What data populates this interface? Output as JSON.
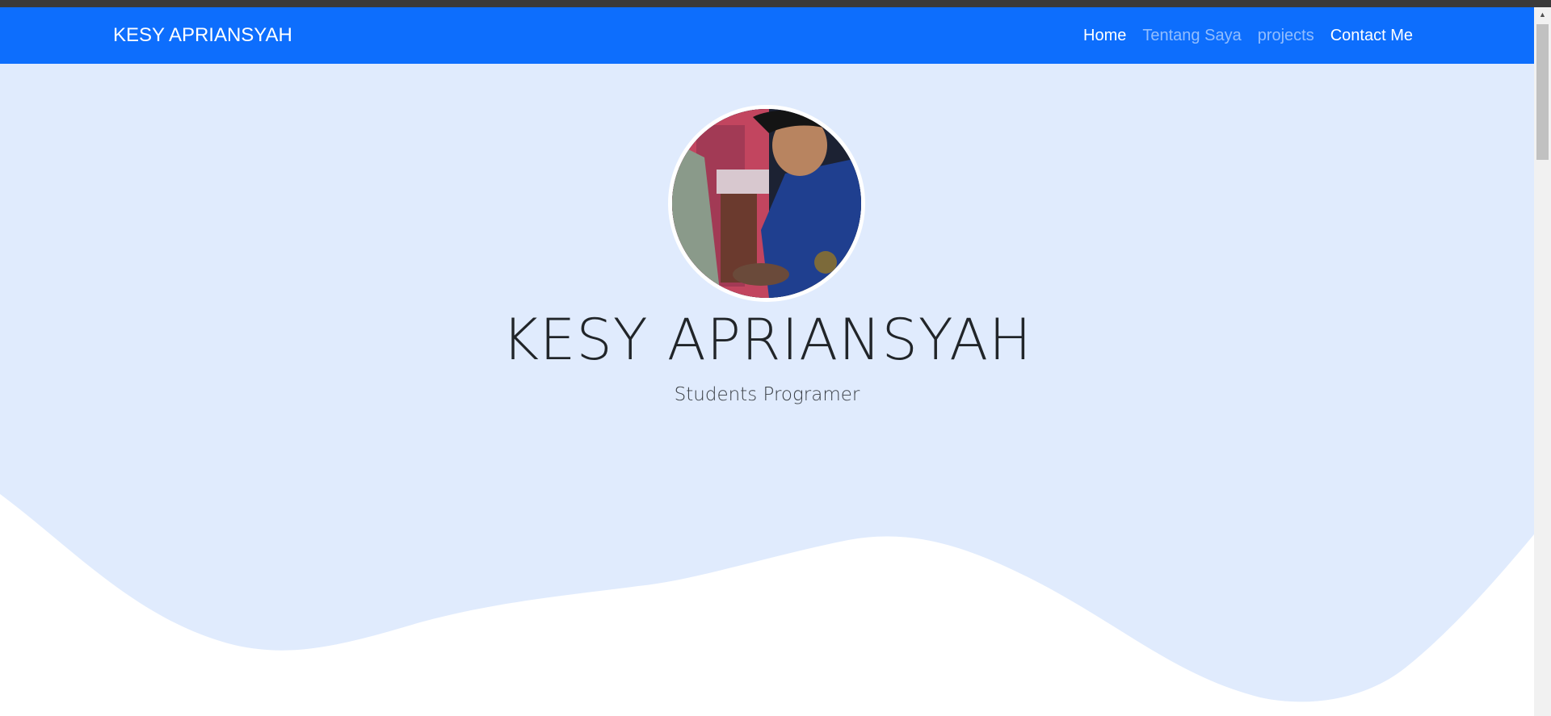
{
  "navbar": {
    "brand": "KESY APRIANSYAH",
    "links": [
      {
        "label": "Home",
        "state": "active"
      },
      {
        "label": "Tentang Saya",
        "state": "muted"
      },
      {
        "label": "projects",
        "state": "muted"
      },
      {
        "label": "Contact Me",
        "state": "active"
      }
    ]
  },
  "hero": {
    "title": "KESY APRIANSYAH",
    "subtitle": "Students Programer",
    "avatar_icon": "profile-photo"
  },
  "colors": {
    "navbar_bg": "#0d6efd",
    "hero_bg": "#e0ebfd",
    "wave_fill": "#ffffff",
    "text_dark": "#212529"
  }
}
